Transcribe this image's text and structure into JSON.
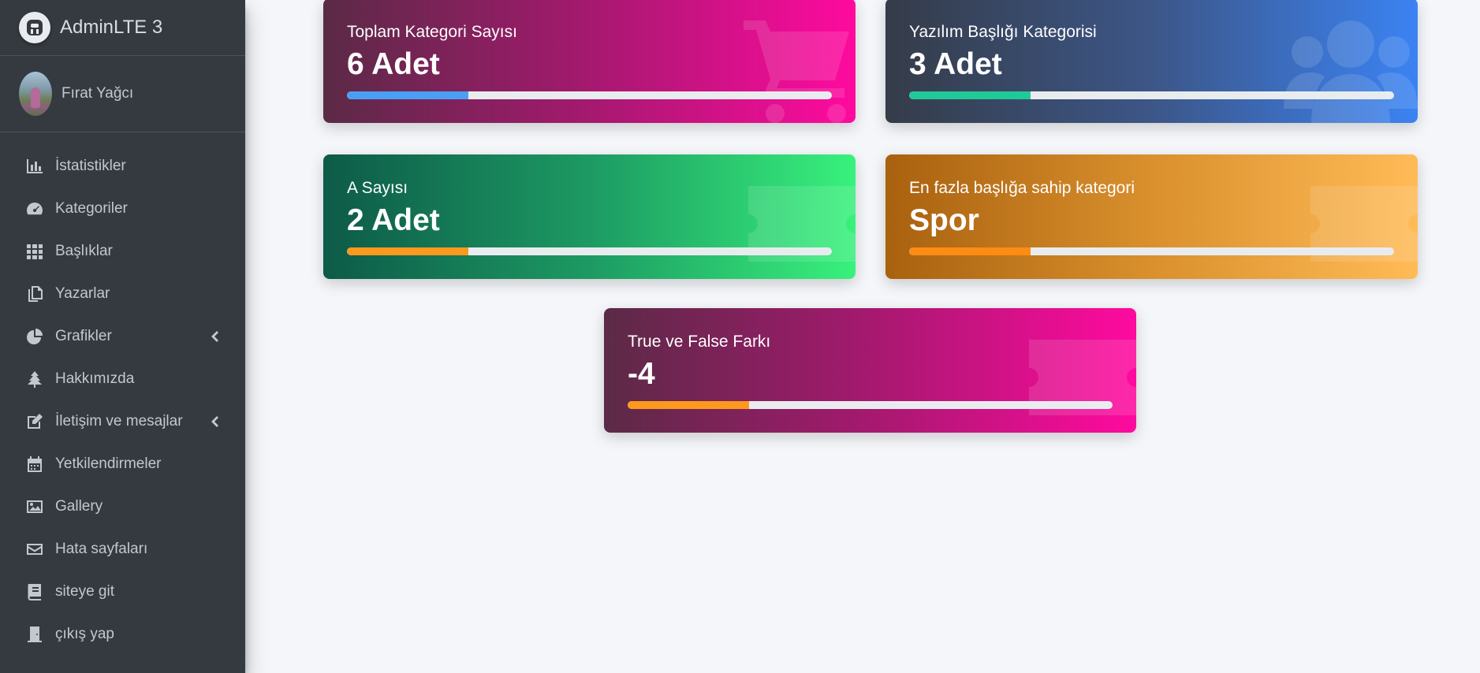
{
  "brand": {
    "title": "AdminLTE 3",
    "logo_icon": "adminlte-logo-icon"
  },
  "user": {
    "name": "Fırat Yağcı"
  },
  "sidebar": {
    "items": [
      {
        "label": "İstatistikler",
        "icon": "bar-chart-icon"
      },
      {
        "label": "Kategoriler",
        "icon": "tachometer-icon"
      },
      {
        "label": "Başlıklar",
        "icon": "grid-icon"
      },
      {
        "label": "Yazarlar",
        "icon": "copy-icon"
      },
      {
        "label": "Grafikler",
        "icon": "pie-chart-icon",
        "has_submenu": true
      },
      {
        "label": "Hakkımızda",
        "icon": "tree-icon"
      },
      {
        "label": "İletişim ve mesajlar",
        "icon": "edit-icon",
        "has_submenu": true
      },
      {
        "label": "Yetkilendirmeler",
        "icon": "calendar-icon"
      },
      {
        "label": "Gallery",
        "icon": "image-icon"
      },
      {
        "label": "Hata sayfaları",
        "icon": "envelope-icon"
      },
      {
        "label": "siteye git",
        "icon": "book-icon"
      },
      {
        "label": "çıkış yap",
        "icon": "door-icon"
      }
    ]
  },
  "cards": [
    {
      "label": "Toplam Kategori Sayısı",
      "value": "6 Adet",
      "progress_percent": 25,
      "progress_color": "#4a9ff5",
      "icon": "shopping-cart-icon"
    },
    {
      "label": "Yazılım Başlığı Kategorisi",
      "value": "3 Adet",
      "progress_percent": 25,
      "progress_color": "#20c997",
      "icon": "users-icon"
    },
    {
      "label": "A Sayısı",
      "value": "2 Adet",
      "progress_percent": 25,
      "progress_color": "#fd9a1e",
      "icon": "ticket-icon"
    },
    {
      "label": "En fazla başlığa sahip kategori",
      "value": "Spor",
      "progress_percent": 25,
      "progress_color": "#fd8c14",
      "icon": "ticket-icon"
    },
    {
      "label": "True ve False Farkı",
      "value": "-4",
      "progress_percent": 25,
      "progress_color": "#fd9a1e",
      "icon": "ticket-icon"
    }
  ]
}
